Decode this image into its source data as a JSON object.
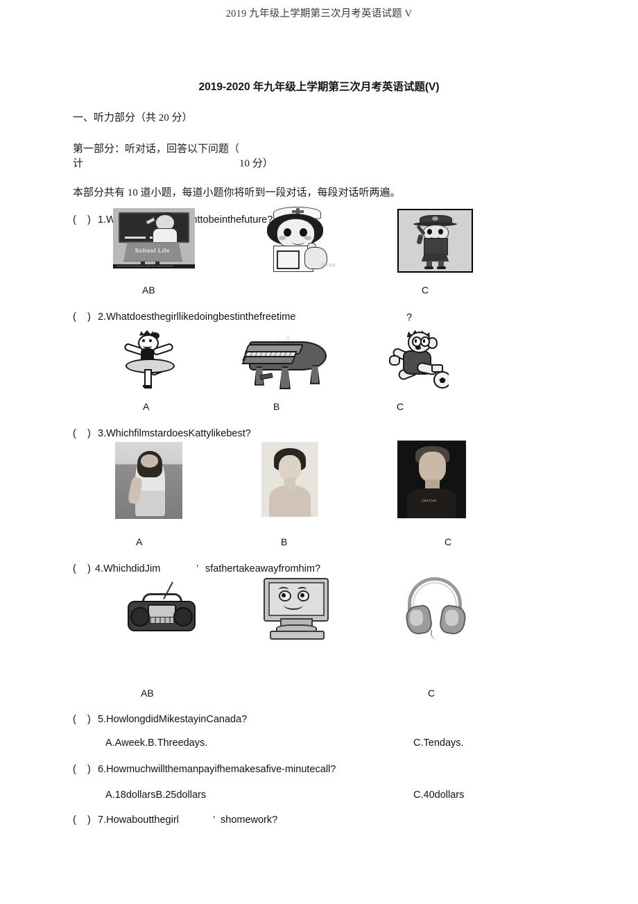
{
  "document": {
    "running_header": "2019 九年级上学期第三次月考英语试题 V",
    "title": "2019-2020 年九年级上学期第三次月考英语试题(V)",
    "section_heading": "一、听力部分（共 20 分）",
    "part_heading_line1": "第一部分：听对话，回答以下问题（",
    "part_heading_line2_left": "计",
    "part_heading_line2_right": "10 分）",
    "instructions": "本部分共有 10 道小题，每道小题你将听到一段对话，每段对话听两遍。"
  },
  "questions": [
    {
      "number": "1",
      "bracket": "(    )",
      "text": "1.Whatdoesthegirlwanttobeinthefuture?",
      "choice_labels": [
        "AB",
        "C"
      ],
      "images": [
        {
          "alt": "teacher at blackboard",
          "caption": "School Life"
        },
        {
          "alt": "nurse giving thumbs up",
          "watermark": "图片素材"
        },
        {
          "alt": "police officer saluting"
        }
      ]
    },
    {
      "number": "2",
      "bracket": "(    )",
      "text": "2.Whatdoesthegirllikedoingbestinthefreetime",
      "question_mark": "?",
      "choice_labels": [
        "A",
        "B",
        "C"
      ],
      "images": [
        {
          "alt": "ballet dancer"
        },
        {
          "alt": "grand piano"
        },
        {
          "alt": "boy playing soccer"
        }
      ]
    },
    {
      "number": "3",
      "bracket": "(    )",
      "text": "3.WhichfilmstardoesKattylikebest?",
      "choice_labels": [
        "A",
        "B",
        "C"
      ],
      "images": [
        {
          "alt": "young woman photo"
        },
        {
          "alt": "classic actress portrait"
        },
        {
          "alt": "actor portrait",
          "watermark": "Lnn.Com"
        }
      ]
    },
    {
      "number": "4",
      "bracket": "(    )",
      "text_left": "4.WhichdidJim",
      "apostrophe": "’",
      "text_right": "sfathertakeawayfromhim?",
      "choice_labels": [
        "AB",
        "C"
      ],
      "images": [
        {
          "alt": "portable radio boombox"
        },
        {
          "alt": "computer monitor with smiling face"
        },
        {
          "alt": "headphones"
        }
      ]
    },
    {
      "number": "5",
      "bracket": "(    )",
      "text": "5.HowlongdidMikestayinCanada?",
      "options_left": "A.Aweek.B.Threedays.",
      "options_right": "C.Tendays."
    },
    {
      "number": "6",
      "bracket": "(    )",
      "text": "6.Howmuchwillthemanpayifhemakesafive-minutecall?",
      "options_left": "A.18dollarsB.25dollars",
      "options_right": "C.40dollars"
    },
    {
      "number": "7",
      "bracket": "(    )",
      "text_left": "7.Howaboutthegirl",
      "apostrophe": "’",
      "text_right": "shomework?"
    }
  ]
}
